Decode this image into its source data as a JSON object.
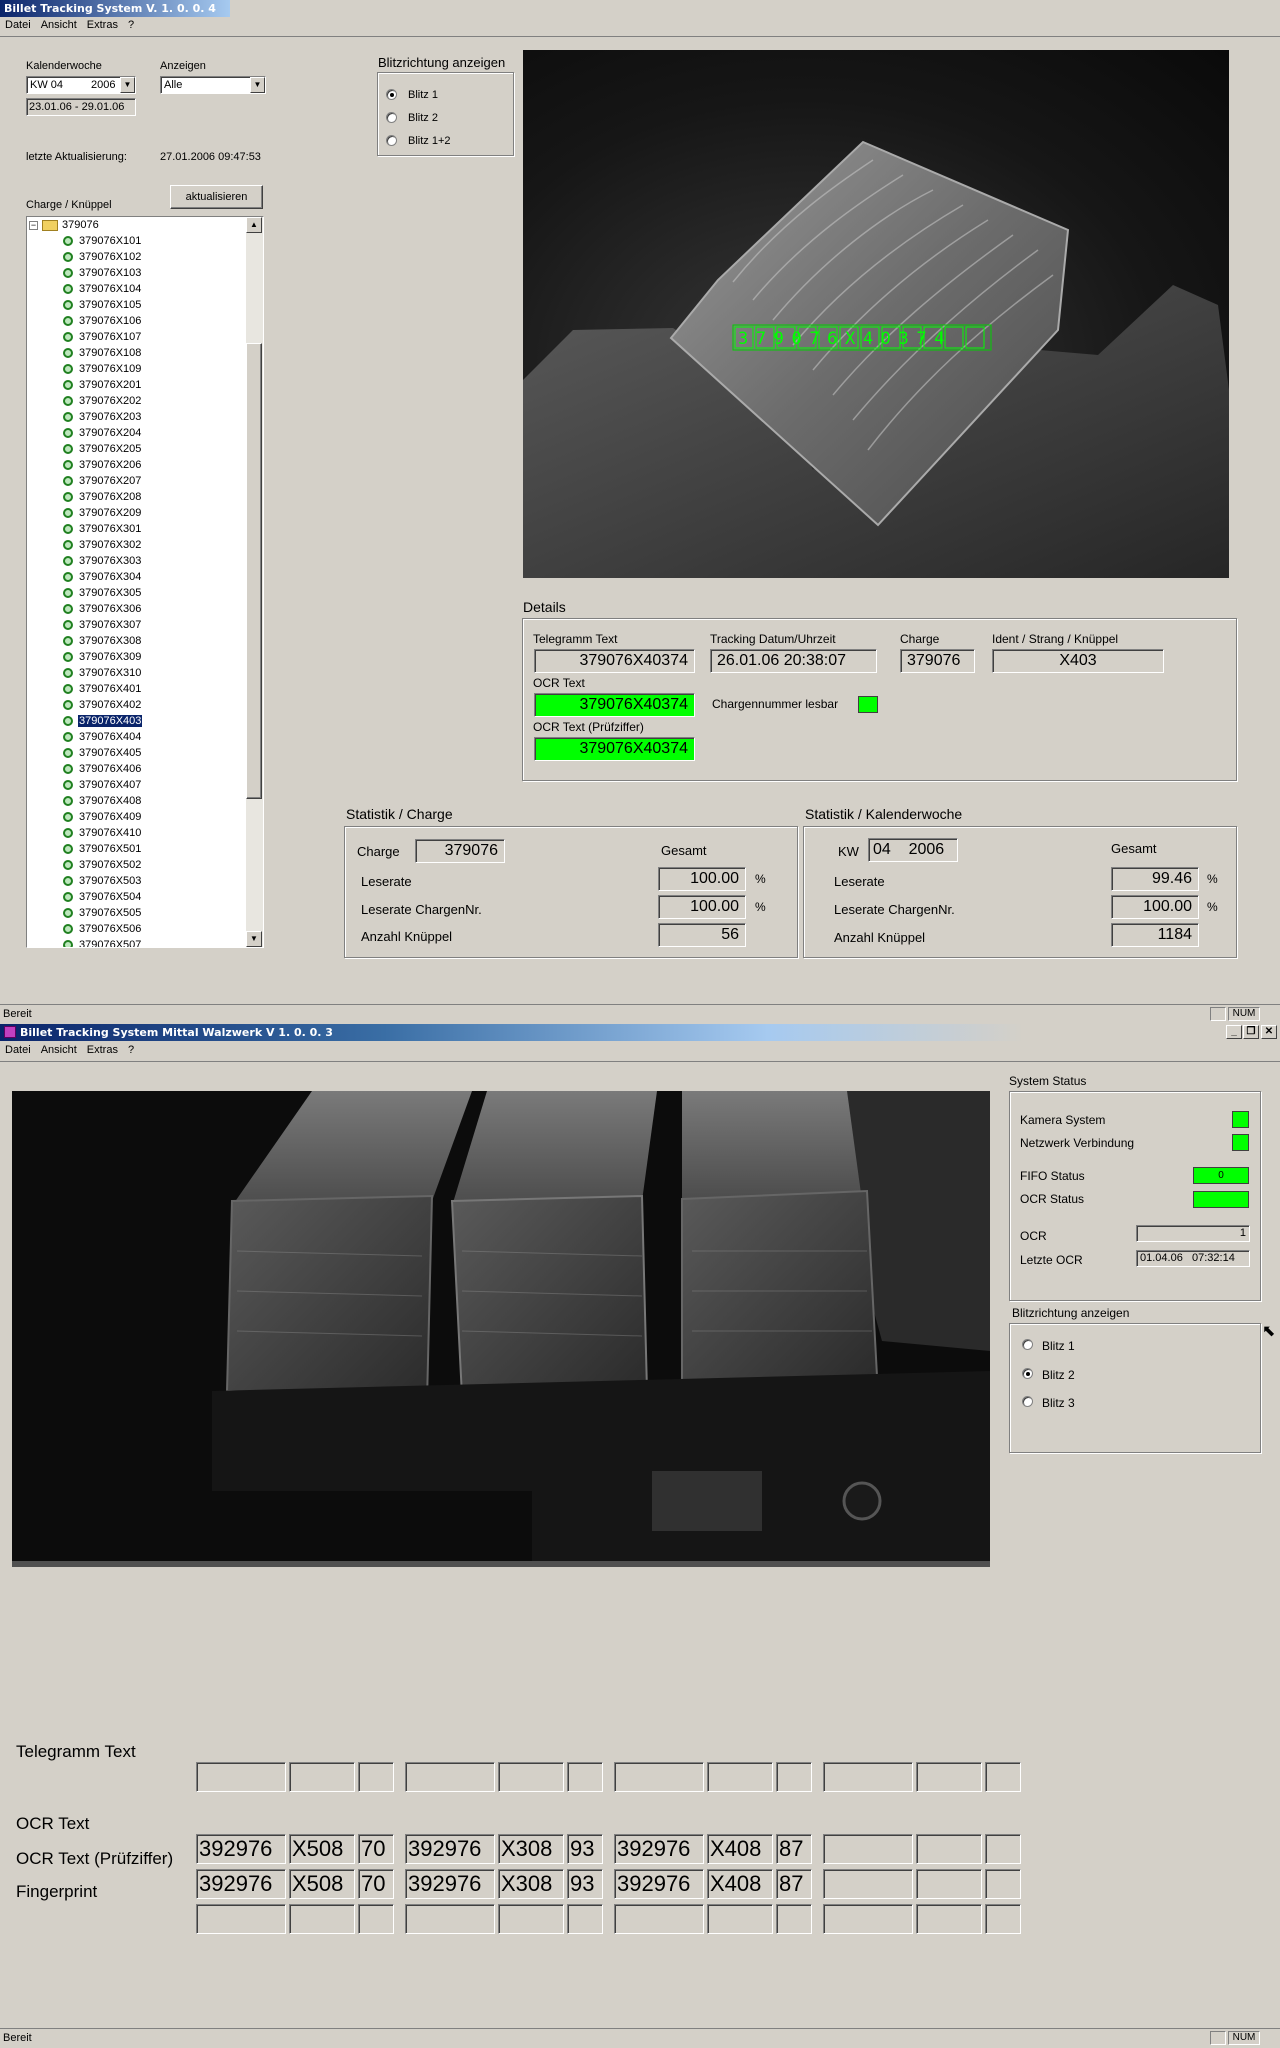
{
  "win1": {
    "title": "Billet Tracking System  V. 1. 0. 0. 4",
    "menu": [
      "Datei",
      "Ansicht",
      "Extras",
      "?"
    ],
    "kalenderwoche": {
      "label": "Kalenderwoche",
      "kw": "KW 04",
      "year": "2006",
      "range": "23.01.06  -  29.01.06"
    },
    "anzeigen": {
      "label": "Anzeigen",
      "value": "Alle"
    },
    "update": {
      "label": "letzte Aktualisierung:",
      "value": "27.01.2006    09:47:53"
    },
    "tree_label": "Charge / Knüppel",
    "refresh_button": "aktualisieren",
    "tree": {
      "root": "379076",
      "items": [
        "379076X101",
        "379076X102",
        "379076X103",
        "379076X104",
        "379076X105",
        "379076X106",
        "379076X107",
        "379076X108",
        "379076X109",
        "379076X201",
        "379076X202",
        "379076X203",
        "379076X204",
        "379076X205",
        "379076X206",
        "379076X207",
        "379076X208",
        "379076X209",
        "379076X301",
        "379076X302",
        "379076X303",
        "379076X304",
        "379076X305",
        "379076X306",
        "379076X307",
        "379076X308",
        "379076X309",
        "379076X310",
        "379076X401",
        "379076X402",
        "379076X403",
        "379076X404",
        "379076X405",
        "379076X406",
        "379076X407",
        "379076X408",
        "379076X409",
        "379076X410",
        "379076X501",
        "379076X502",
        "379076X503",
        "379076X504",
        "379076X505",
        "379076X506",
        "379076X507"
      ],
      "selected": "379076X403"
    },
    "blitz": {
      "label": "Blitzrichtung anzeigen",
      "options": [
        "Blitz 1",
        "Blitz 2",
        "Blitz 1+2"
      ],
      "selected": "Blitz 1"
    },
    "photo_ocr_overlay": "379076X40374",
    "details": {
      "label": "Details",
      "telegramm_label": "Telegramm Text",
      "telegramm_value": "379076X40374",
      "tracking_label": "Tracking Datum/Uhrzeit",
      "tracking_value": "26.01.06  20:38:07",
      "charge_label": "Charge",
      "charge_value": "379076",
      "ident_label": "Ident / Strang / Knüppel",
      "ident_value": "X403",
      "ocr_label": "OCR Text",
      "ocr_value": "379076X40374",
      "lesbar_label": "Chargennummer lesbar",
      "ocr_pz_label": "OCR Text (Prüfziffer)",
      "ocr_pz_value": "379076X40374"
    },
    "stat_charge": {
      "label": "Statistik / Charge",
      "charge_label": "Charge",
      "charge_value": "379076",
      "gesamt_label": "Gesamt",
      "rows": [
        {
          "label": "Leserate",
          "value": "100.00",
          "unit": "%"
        },
        {
          "label": "Leserate ChargenNr.",
          "value": "100.00",
          "unit": "%"
        },
        {
          "label": "Anzahl Knüppel",
          "value": "56",
          "unit": ""
        }
      ]
    },
    "stat_kw": {
      "label": "Statistik / Kalenderwoche",
      "kw_label": "KW",
      "kw_value": "04    2006",
      "gesamt_label": "Gesamt",
      "rows": [
        {
          "label": "Leserate",
          "value": "99.46",
          "unit": "%"
        },
        {
          "label": "Leserate ChargenNr.",
          "value": "100.00",
          "unit": "%"
        },
        {
          "label": "Anzahl Knüppel",
          "value": "1184",
          "unit": ""
        }
      ]
    },
    "status": {
      "text": "Bereit",
      "num": "NUM"
    }
  },
  "win2": {
    "title": "Billet Tracking System  Mittal Walzwerk  V 1. 0. 0. 3",
    "menu": [
      "Datei",
      "Ansicht",
      "Extras",
      "?"
    ],
    "system_status": {
      "label": "System Status",
      "kamera": "Kamera System",
      "netzwerk": "Netzwerk Verbindung",
      "fifo": "FIFO Status",
      "fifo_value": "0",
      "ocr_status": "OCR Status",
      "ocr": "OCR",
      "ocr_value": "1",
      "letzte_ocr": "Letzte OCR",
      "letzte_ocr_value": "01.04.06   07:32:14"
    },
    "blitz": {
      "label": "Blitzrichtung anzeigen",
      "options": [
        "Blitz 1",
        "Blitz 2",
        "Blitz 3"
      ],
      "selected": "Blitz 2"
    },
    "grid": {
      "row_labels": [
        "Telegramm Text",
        "OCR Text",
        "OCR Text (Prüfziffer)",
        "Fingerprint"
      ],
      "ocr": [
        [
          "392976",
          "X508",
          "70"
        ],
        [
          "392976",
          "X308",
          "93"
        ],
        [
          "392976",
          "X408",
          "87"
        ],
        [
          "",
          "",
          ""
        ]
      ],
      "ocr_pz": [
        [
          "392976",
          "X508",
          "70"
        ],
        [
          "392976",
          "X308",
          "93"
        ],
        [
          "392976",
          "X408",
          "87"
        ],
        [
          "",
          "",
          ""
        ]
      ]
    },
    "status": {
      "text": "Bereit",
      "num": "NUM"
    }
  },
  "colors": {
    "ok_green": "#00ff00",
    "title_blue": "#0a246a",
    "window_gray": "#d4d0c8"
  }
}
